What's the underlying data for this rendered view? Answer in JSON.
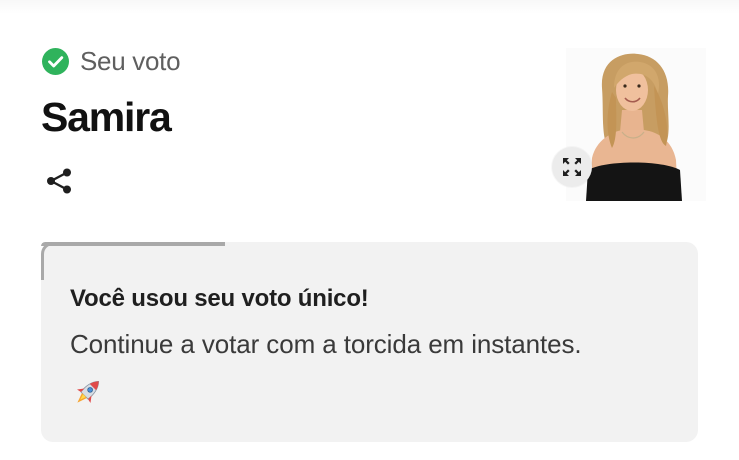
{
  "vote": {
    "status_label": "Seu voto",
    "status_icon": "check-circle-icon",
    "status_color": "#2fb35c",
    "candidate_name": "Samira"
  },
  "actions": {
    "share_icon": "share-icon",
    "expand_icon": "expand-icon"
  },
  "candidate_photo": {
    "icon": "candidate-photo"
  },
  "notice": {
    "title": "Você usou seu voto único!",
    "message": "Continue a votar com a torcida em instantes.",
    "emoji_icon": "rocket-icon",
    "progress_fraction": 0.28,
    "progress_color": "#a9a9a9",
    "background_color": "#f2f2f2"
  }
}
